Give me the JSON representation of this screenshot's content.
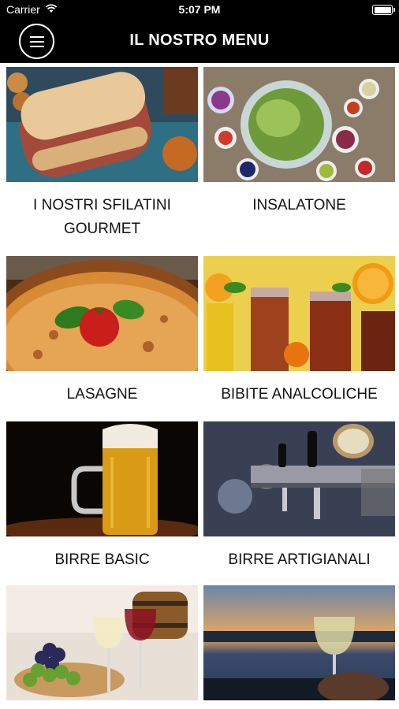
{
  "status_bar": {
    "carrier": "Carrier",
    "time": "5:07 PM"
  },
  "header": {
    "title": "IL NOSTRO MENU"
  },
  "menu_items": [
    {
      "label": "I NOSTRI SFILATINI GOURMET"
    },
    {
      "label": "INSALATONE"
    },
    {
      "label": "LASAGNE"
    },
    {
      "label": "BIBITE ANALCOLICHE"
    },
    {
      "label": "BIRRE BASIC"
    },
    {
      "label": "BIRRE ARTIGIANALI"
    },
    {
      "label": ""
    },
    {
      "label": ""
    }
  ]
}
